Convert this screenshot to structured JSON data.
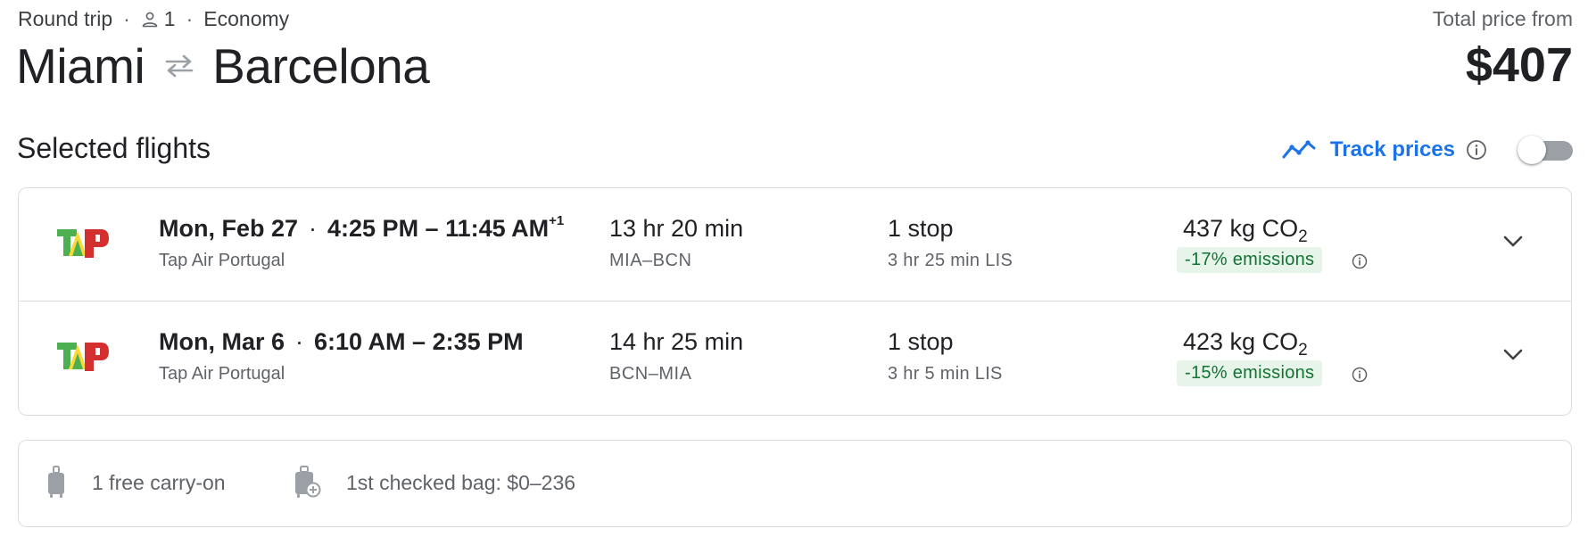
{
  "header": {
    "trip_type": "Round trip",
    "passengers": "1",
    "cabin_class": "Economy",
    "origin": "Miami",
    "destination": "Barcelona",
    "price_label": "Total price from",
    "price": "$407"
  },
  "section": {
    "title": "Selected flights",
    "track_label": "Track prices",
    "track_enabled": false
  },
  "flights": [
    {
      "date": "Mon, Feb 27",
      "times": "4:25 PM – 11:45 AM",
      "day_offset": "+1",
      "airline": "Tap Air Portugal",
      "duration": "13 hr 20 min",
      "airports": "MIA–BCN",
      "stops": "1 stop",
      "layover": "3 hr 25 min LIS",
      "co2_value": "437 kg CO",
      "co2_sub": "2",
      "emissions": "-17% emissions"
    },
    {
      "date": "Mon, Mar 6",
      "times": "6:10 AM – 2:35 PM",
      "day_offset": "",
      "airline": "Tap Air Portugal",
      "duration": "14 hr 25 min",
      "airports": "BCN–MIA",
      "stops": "1 stop",
      "layover": "3 hr 5 min LIS",
      "co2_value": "423 kg CO",
      "co2_sub": "2",
      "emissions": "-15% emissions"
    }
  ],
  "baggage": {
    "carry_on": "1 free carry-on",
    "checked": "1st checked bag: $0–236"
  },
  "colors": {
    "accent": "#1a73e8",
    "emission_bg": "#e6f4ea",
    "emission_text": "#137333",
    "border": "#dadce0"
  },
  "icons": {
    "person": "person-icon",
    "swap": "swap-arrows-icon",
    "trend": "trend-line-icon",
    "info": "info-icon",
    "expand": "chevron-down-icon",
    "carry_on": "carry-on-bag-icon",
    "checked_bag": "checked-bag-icon",
    "airline_logo": "tap-logo"
  }
}
